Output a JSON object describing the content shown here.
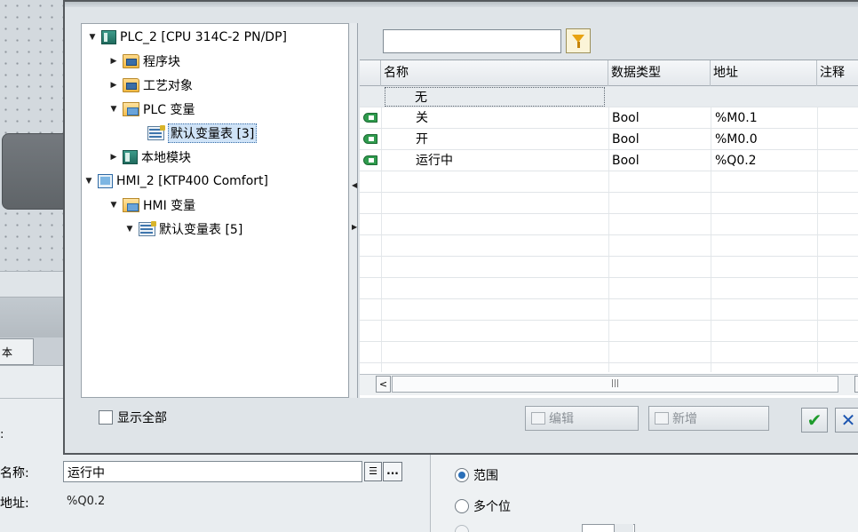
{
  "background": {
    "left_tab_label": "本",
    "props_dot": ":",
    "name_label": "名称:",
    "addr_label": "地址:",
    "name_value": "运行中",
    "name_list_glyph": "☰",
    "name_browse_glyph": "...",
    "addr_value": "%Q0.2",
    "radio_range": "范围",
    "radio_multibit": "多个位"
  },
  "tree": {
    "items": [
      {
        "label": "PLC_2 [CPU 314C-2 PN/DP]",
        "twisty": "▼",
        "icon": "cpu-icon"
      },
      {
        "label": "程序块",
        "twisty": "▶",
        "icon": "program-blocks-folder-icon"
      },
      {
        "label": "工艺对象",
        "twisty": "▶",
        "icon": "technology-objects-folder-icon"
      },
      {
        "label": "PLC 变量",
        "twisty": "▼",
        "icon": "plc-tags-folder-icon"
      },
      {
        "label": "默认变量表 [3]",
        "twisty": "",
        "icon": "tag-table-icon"
      },
      {
        "label": "本地模块",
        "twisty": "▶",
        "icon": "local-modules-icon"
      },
      {
        "label": "HMI_2 [KTP400 Comfort]",
        "twisty": "▼",
        "icon": "hmi-device-icon"
      },
      {
        "label": "HMI 变量",
        "twisty": "▼",
        "icon": "hmi-tags-folder-icon"
      },
      {
        "label": "默认变量表 [5]",
        "twisty": "▼",
        "icon": "tag-table-icon"
      }
    ]
  },
  "splitter": {
    "left_arrow": "◀",
    "right_arrow": "▶"
  },
  "grid": {
    "headers": [
      "名称",
      "数据类型",
      "地址",
      "注释"
    ],
    "rows": [
      {
        "name": "无",
        "type": "",
        "address": "",
        "icon": ""
      },
      {
        "name": "关",
        "type": "Bool",
        "address": "%M0.1",
        "icon": "tag-icon"
      },
      {
        "name": "开",
        "type": "Bool",
        "address": "%M0.0",
        "icon": "tag-icon"
      },
      {
        "name": "运行中",
        "type": "Bool",
        "address": "%Q0.2",
        "icon": "tag-icon"
      }
    ]
  },
  "scroll": {
    "left": "<",
    "thumb_grip": "|||"
  },
  "footer": {
    "show_all": "显示全部",
    "edit": "编辑",
    "new": "新增",
    "ok_glyph": "✔",
    "cancel_glyph": "✕"
  },
  "colors": {
    "accent_ok": "#1e9b2c",
    "accent_cancel": "#1c55b0",
    "tag_icon": "#2f9b4d",
    "filter_icon": "#e8a313"
  }
}
